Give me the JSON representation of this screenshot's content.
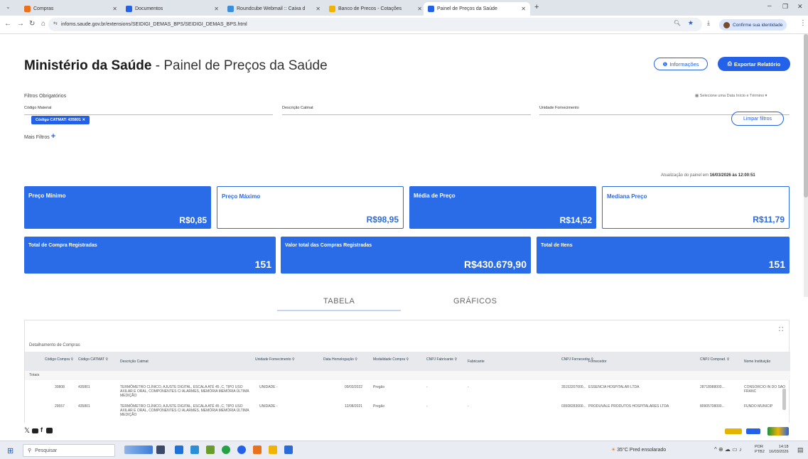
{
  "browser": {
    "tabs": [
      {
        "label": "Compras",
        "color": "#e8711a"
      },
      {
        "label": "Documentos",
        "color": "#2361e8"
      },
      {
        "label": "Roundcube Webmail :: Caixa d",
        "color": "#3a8fd8"
      },
      {
        "label": "Banco de Precos - Cotações",
        "color": "#f0b400"
      },
      {
        "label": "Painel de Preços da Saúde",
        "color": "#2361e8"
      }
    ],
    "url": "infoms.saude.gov.br/extensions/SEIDIGI_DEMAS_BPS/SEIDIGI_DEMAS_BPS.html",
    "profile": "Confirme sua identidade"
  },
  "header": {
    "title_bold": "Ministério da Saúde",
    "title_rest": " - Painel de Preços da Saúde",
    "info_btn": "Informações",
    "export_btn": "Exportar Relatório"
  },
  "filters": {
    "label": "Filtros Obrigatórios",
    "date_select": "Selecione uma Data Início e Término",
    "field1": "Código Material",
    "field2": "Descrição Catmat",
    "field3": "Unidade Fornecimento",
    "more": "Mais Filtros",
    "chip": "Código CATMAT: 435801",
    "clear": "Limpar filtros",
    "update_prefix": "Atualização do painel em",
    "update_value": "16/03/2026 às 12:00:51"
  },
  "cards": [
    {
      "title": "Preço Mínimo",
      "value": "R$0,85"
    },
    {
      "title": "Preço Máximo",
      "value": "R$98,95"
    },
    {
      "title": "Média de Preço",
      "value": "R$14,52"
    },
    {
      "title": "Mediana Preço",
      "value": "R$11,79"
    },
    {
      "title": "Total de Compra Registradas",
      "value": "151"
    },
    {
      "title": "Valor total das Compras Registradas",
      "value": "R$430.679,90"
    },
    {
      "title": "Total de Itens",
      "value": "151"
    }
  ],
  "view_tabs": {
    "table": "TABELA",
    "charts": "GRÁFICOS"
  },
  "table": {
    "caption": "Detalhamento de Compras",
    "headers": [
      "Código Compra",
      "Código CATMAT",
      "Descrição Catmat",
      "Unidade Fornecimento",
      "Data Homologação",
      "Modalidade Compra",
      "CNPJ Fabricante",
      "Fabricante",
      "CNPJ Fornecedor",
      "Fornecedor",
      "CNPJ Comprad.",
      "Nome Instituição"
    ],
    "totals_label": "Totais",
    "rows": [
      [
        "30808",
        "435801",
        "TERMÔMETRO CLÍNICO, AJUSTE DIGITAL, ESCALA ATÉ 45 ,C, TIPO USO AXILAR E ORAL, COMPONENTES C/ ALARMES, MEMÓRIA MEMÓRIA ÚLTIMA MEDIÇÃO",
        "UNIDADE -",
        "09/03/2022",
        "Pregão",
        "-",
        "-",
        "35153207000...",
        "ESSENCIA HOSPITALAR LTDA",
        "28718988000...",
        "CONSORCIO IN DO SAO FRANC"
      ],
      [
        "29557",
        "435801",
        "TERMÔMETRO CLÍNICO, AJUSTE DIGITAL, ESCALA ATÉ 45 ,C, TIPO USO AXILAR E ORAL, COMPONENTES C/ ALARMES, MEMÓRIA MEMÓRIA ÚLTIMA MEDIÇÃO",
        "UNIDADE -",
        "12/08/2021",
        "Pregão",
        "-",
        "-",
        "03508283000...",
        "PRODUVALE PRODUTOS HOSPITALARES LTDA",
        "80905708000...",
        "FUNDO MUNICIP"
      ]
    ]
  },
  "taskbar": {
    "search": "Pesquisar",
    "weather": "35°C  Pred ensolarado",
    "lang": "POR",
    "lang2": "PTB2",
    "time": "14:18",
    "date": "16/03/2026"
  }
}
